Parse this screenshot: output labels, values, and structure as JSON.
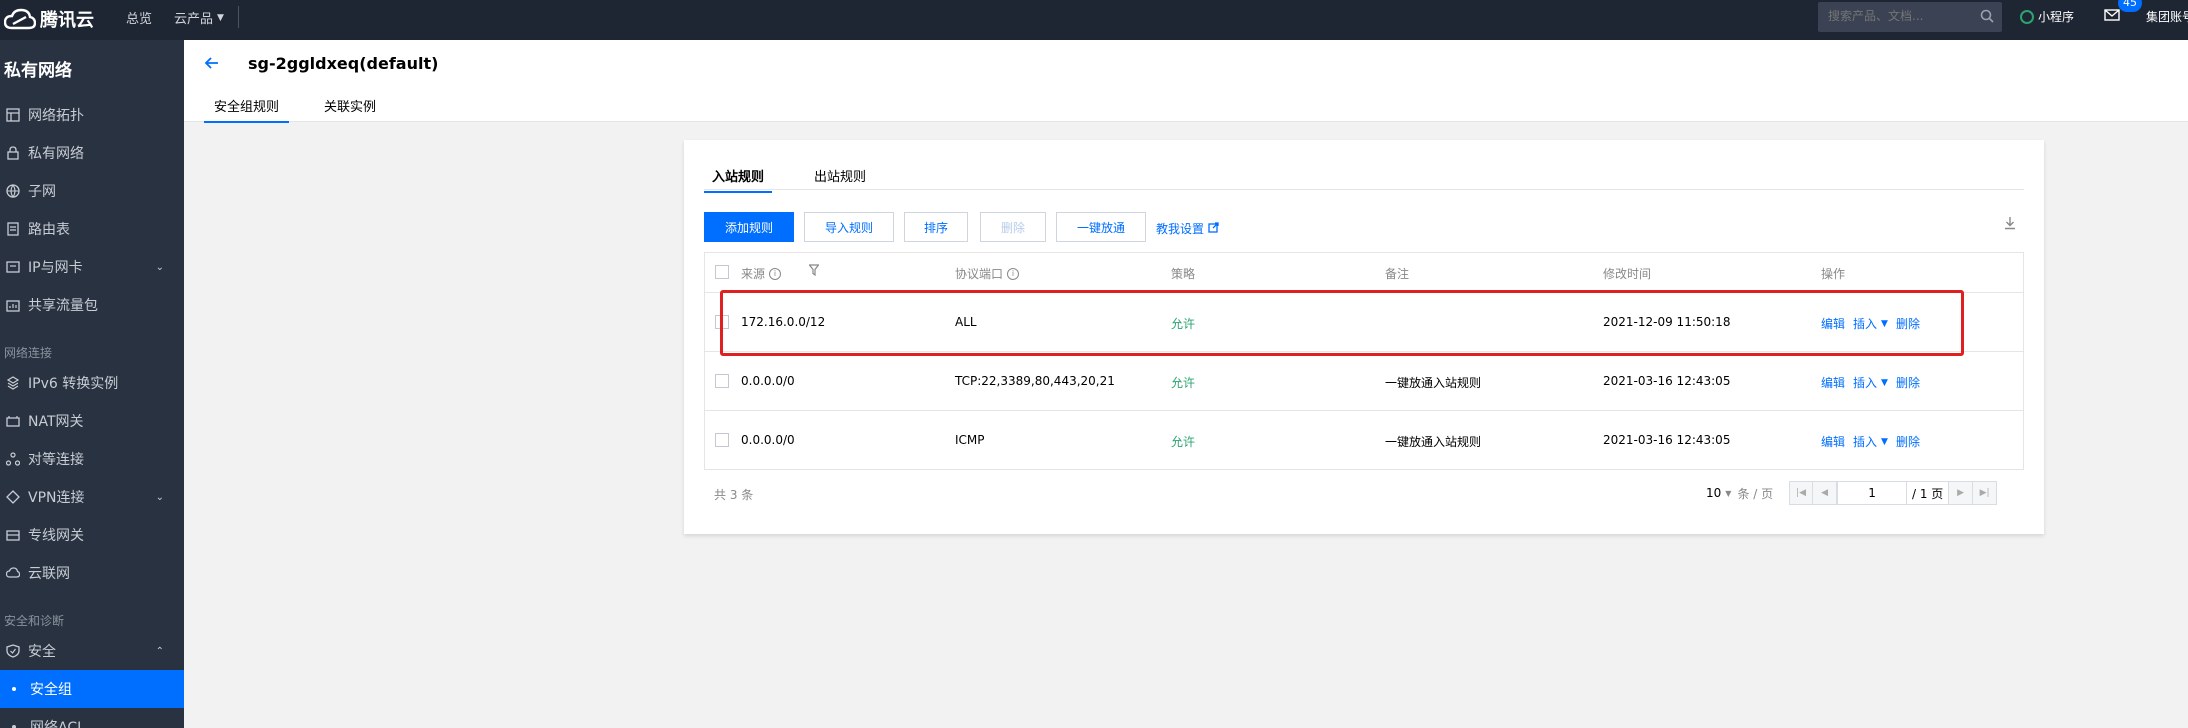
{
  "topbar": {
    "brand": "腾讯云",
    "nav_overview": "总览",
    "nav_products": "云产品",
    "search_placeholder": "搜索产品、文档...",
    "mini_program": "小程序",
    "mail_badge": "45",
    "account": "集团账号"
  },
  "sidebar": {
    "title": "私有网络",
    "items": [
      {
        "label": "网络拓扑",
        "icon": "topology-icon"
      },
      {
        "label": "私有网络",
        "icon": "lock-icon"
      },
      {
        "label": "子网",
        "icon": "globe-icon"
      },
      {
        "label": "路由表",
        "icon": "route-table-icon"
      },
      {
        "label": "IP与网卡",
        "icon": "nic-icon"
      },
      {
        "label": "共享流量包",
        "icon": "package-icon"
      }
    ],
    "group_connect": "网络连接",
    "connect_items": [
      {
        "label": "IPv6 转换实例",
        "icon": "ipv6-icon"
      },
      {
        "label": "NAT网关",
        "icon": "nat-icon"
      },
      {
        "label": "对等连接",
        "icon": "peering-icon"
      },
      {
        "label": "VPN连接",
        "icon": "vpn-icon"
      },
      {
        "label": "专线网关",
        "icon": "gateway-icon"
      },
      {
        "label": "云联网",
        "icon": "cloud-net-icon"
      }
    ],
    "group_security": "安全和诊断",
    "security_label": "安全",
    "security_group_label": "安全组",
    "network_acl_label": "网络ACL"
  },
  "header": {
    "title": "sg-2ggldxeq(default)",
    "tabs": [
      "安全组规则",
      "关联实例"
    ]
  },
  "panel": {
    "tabs": [
      "入站规则",
      "出站规则"
    ],
    "buttons": {
      "add": "添加规则",
      "import": "导入规则",
      "sort": "排序",
      "delete": "删除",
      "allow_all": "一键放通"
    },
    "help_link": "教我设置",
    "columns": {
      "source": "来源",
      "protocol_port": "协议端口",
      "policy": "策略",
      "remark": "备注",
      "modified": "修改时间",
      "actions": "操作"
    },
    "rows": [
      {
        "source": "172.16.0.0/12",
        "protocol_port": "ALL",
        "policy": "允许",
        "remark": "",
        "modified": "2021-12-09 11:50:18"
      },
      {
        "source": "0.0.0.0/0",
        "protocol_port": "TCP:22,3389,80,443,20,21",
        "policy": "允许",
        "remark": "一键放通入站规则",
        "modified": "2021-03-16 12:43:05"
      },
      {
        "source": "0.0.0.0/0",
        "protocol_port": "ICMP",
        "policy": "允许",
        "remark": "一键放通入站规则",
        "modified": "2021-03-16 12:43:05"
      }
    ],
    "actions": {
      "edit": "编辑",
      "insert": "插入",
      "delete": "删除"
    },
    "total": "共 3 条",
    "pager": {
      "page_size": "10",
      "per_page": "条 / 页",
      "current_page": "1",
      "total_pages": "/ 1 页"
    }
  }
}
